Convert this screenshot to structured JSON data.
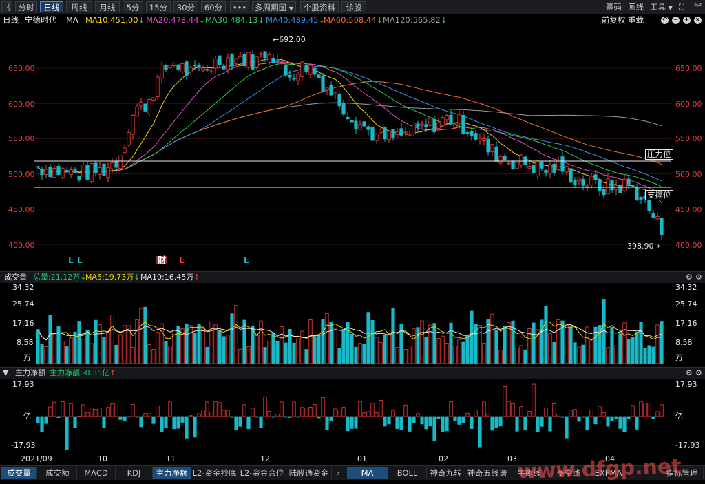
{
  "toolbar": {
    "back_glyph": "《",
    "periods": [
      "分时",
      "日线",
      "周线",
      "月线",
      "5分",
      "15分",
      "30分",
      "60分"
    ],
    "active_period": "日线",
    "more_glyph": "•••",
    "multi_period": "多周期图",
    "stock_info": "个股资料",
    "diagnose": "诊股",
    "right_items": [
      "筹码",
      "画线",
      "工具"
    ]
  },
  "info": {
    "period": "日线",
    "name": "宁德时代",
    "ma_label": "MA",
    "ma10": "MA10:451.00",
    "ma20": "MA20:478.44",
    "ma30": "MA30:484.13",
    "ma40": "MA40:489.45",
    "ma60": "MA60:508.44",
    "ma120": "MA120:565.82",
    "adjust": "前复权",
    "overlay": "重载"
  },
  "colors": {
    "up": "#ff4040",
    "down": "#19b9c8",
    "ma10": "#f3d100",
    "ma20": "#e84dcf",
    "ma30": "#28c858",
    "ma40": "#3a8ee8",
    "ma60": "#f06a30",
    "ma120": "#9a9a9a",
    "axis_text": "#e0403c",
    "grid": "#2a1515"
  },
  "price_axis": [
    "650.00",
    "600.00",
    "550.00",
    "500.00",
    "450.00",
    "400.00"
  ],
  "price_annotations": {
    "high": "692.00",
    "low": "398.90",
    "resistance": "压力位",
    "support": "支撑位"
  },
  "event_marks": [
    "L",
    "L",
    "财",
    "L",
    "L"
  ],
  "volume": {
    "title": "成交量",
    "total": "总量:21.12万",
    "ma5": "MA5:19.73万",
    "ma10": "MA10:16.45万",
    "axis": [
      "34.32",
      "25.74",
      "17.16",
      "8.58",
      "万"
    ]
  },
  "capital": {
    "title": "主力净额",
    "value": "主力净额:-0.35亿",
    "axis_top": "17.93",
    "axis_mid": "亿",
    "axis_bottom": "-17.93"
  },
  "dates": [
    "2021/09",
    "10",
    "11",
    "12",
    "01",
    "02",
    "03",
    "04"
  ],
  "tabs_left": [
    "成交量",
    "成交额",
    "MACD",
    "KDJ",
    "主力净额",
    "L2-资金抄底",
    "L2-资金合位",
    "陆股通资金"
  ],
  "tabs_right": [
    "MA",
    "BOLL",
    "神奇九转",
    "神奇五线谱",
    "牛熊线",
    "多空线",
    "EXPMA",
    "指标管理"
  ],
  "watermark": "www.dfgp.net"
}
